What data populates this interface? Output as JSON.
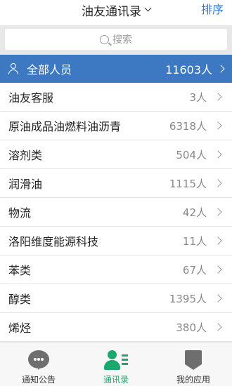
{
  "header": {
    "title": "油友通讯录",
    "sort_label": "排序"
  },
  "search": {
    "placeholder": "搜索"
  },
  "all_members": {
    "label": "全部人员",
    "count": "11603人"
  },
  "groups": [
    {
      "name": "油友客服",
      "count": "3人"
    },
    {
      "name": "原油成品油燃料油沥青",
      "count": "6318人"
    },
    {
      "name": "溶剂类",
      "count": "504人"
    },
    {
      "name": "润滑油",
      "count": "1115人"
    },
    {
      "name": "物流",
      "count": "42人"
    },
    {
      "name": "洛阳维度能源科技",
      "count": "11人"
    },
    {
      "name": "苯类",
      "count": "67人"
    },
    {
      "name": "醇类",
      "count": "1395人"
    },
    {
      "name": "烯烃",
      "count": "380人"
    }
  ],
  "tabs": [
    {
      "label": "通知公告",
      "icon": "chat-bubble-icon"
    },
    {
      "label": "通讯录",
      "icon": "contacts-icon",
      "active": true
    },
    {
      "label": "我的应用",
      "icon": "apps-icon"
    }
  ],
  "colors": {
    "accent": "#3d78c3",
    "active_tab": "#1aa86e",
    "sort": "#2b7bd6"
  }
}
